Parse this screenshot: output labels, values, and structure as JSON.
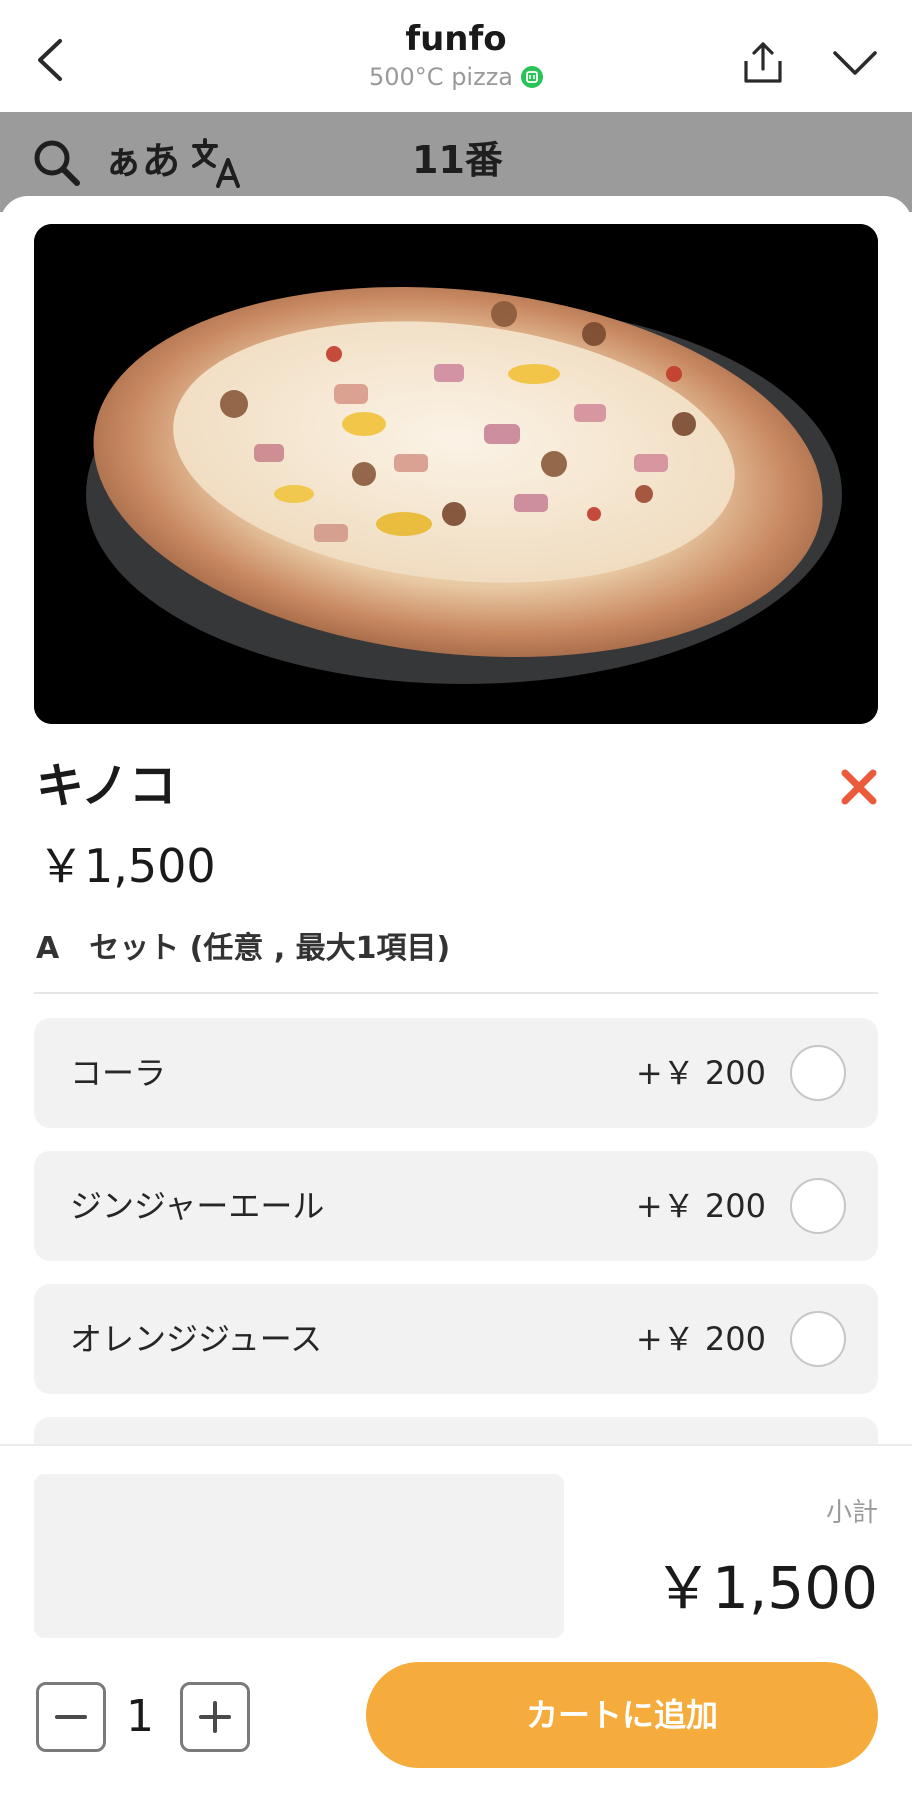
{
  "header": {
    "title": "funfo",
    "subtitle": "500°C pizza"
  },
  "toolbar": {
    "kana_label": "ぁあ",
    "table_label": "11番"
  },
  "item": {
    "name": "キノコ",
    "price": "￥1,500"
  },
  "option_group": {
    "title": "A　セット (任意 , 最大1項目)",
    "options": [
      {
        "name": "コーラ",
        "price": "+￥ 200",
        "selected": false
      },
      {
        "name": "ジンジャーエール",
        "price": "+￥ 200",
        "selected": false
      },
      {
        "name": "オレンジジュース",
        "price": "+￥ 200",
        "selected": false
      }
    ]
  },
  "footer": {
    "subtotal_label": "小計",
    "subtotal_value": "￥1,500",
    "quantity": "1",
    "add_to_cart_label": "カートに追加"
  },
  "colors": {
    "accent": "#f6ac3c",
    "close_red": "#ec5a3c",
    "verified_green": "#2cc25a",
    "toolbar_gray": "#9b9b9b"
  },
  "icons": [
    "back-icon",
    "verified-icon",
    "share-icon",
    "chevron-down-icon",
    "search-icon",
    "translate-icon",
    "close-icon",
    "minus-icon",
    "plus-icon"
  ]
}
